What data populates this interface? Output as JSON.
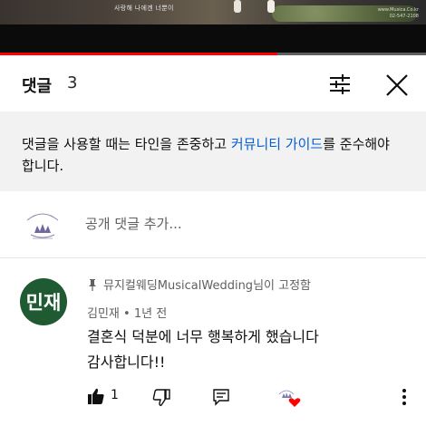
{
  "video": {
    "caption": "사랑해 나에겐 너뿐이",
    "watermark_line1": "www.Musica.Co.kr",
    "watermark_line2": "02-547-2108",
    "progress_fraction": 0.65,
    "colors": {
      "progress": "#ff0000",
      "track": "#5f5f5f"
    }
  },
  "header": {
    "title": "댓글",
    "count": "3",
    "filter_icon": "sort-filter-icon",
    "close_icon": "close-icon"
  },
  "notice": {
    "text_before": "댓글을 사용할 때는 타인을 존중하고 ",
    "link": "커뮤니티 가이드",
    "text_after": "를 준수해야 합니다.",
    "link_color": "#065fd4"
  },
  "add_comment": {
    "placeholder": "공개 댓글 추가...",
    "avatar_text": "MUSICAL WEDDING"
  },
  "comment": {
    "avatar_text": "민재",
    "avatar_color": "#1f5a33",
    "pinned_text": "뮤지컬웨딩MusicalWedding님이 고정함",
    "author": "김민재",
    "time": "• 1년 전",
    "line1": "결혼식 덕분에 너무 행복하게 했습니다",
    "line2": "감사합니다!!",
    "like_count": "1",
    "icons": [
      "pin-icon",
      "thumbs-up-icon",
      "thumbs-down-icon",
      "reply-icon",
      "creator-heart-icon",
      "more-vert-icon"
    ],
    "heart_color": "#ff0000"
  }
}
